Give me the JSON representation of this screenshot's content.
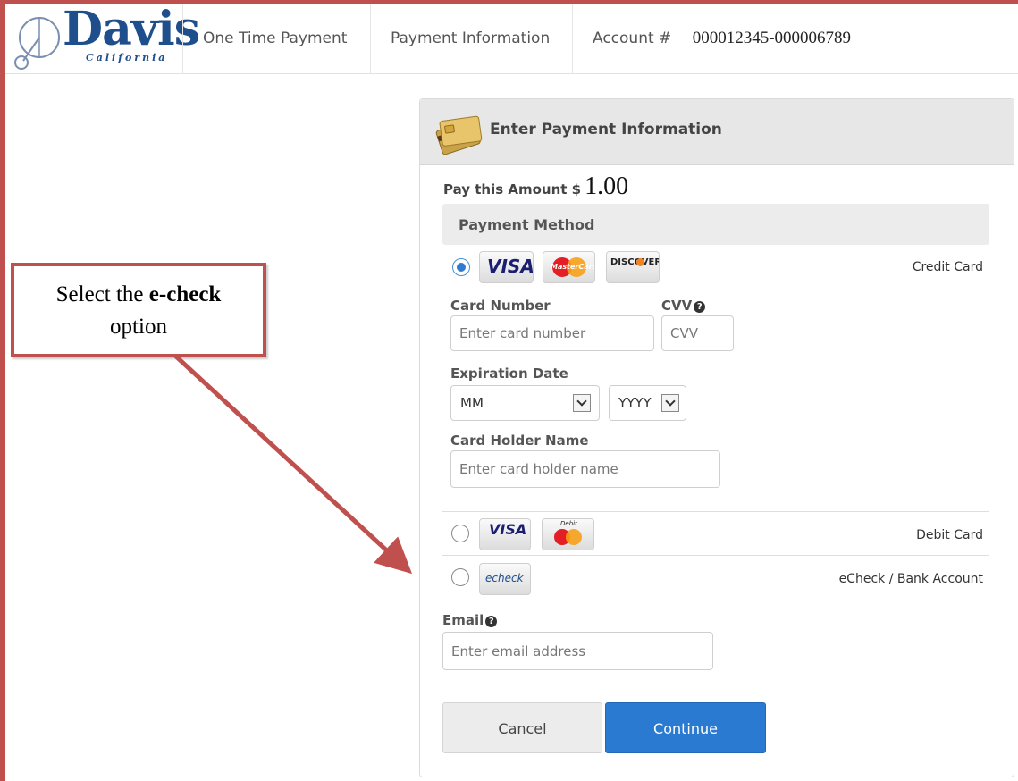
{
  "header": {
    "logo_text": "Davis",
    "logo_subtext": "California",
    "nav": [
      "One Time Payment",
      "Payment Information"
    ],
    "account_label": "Account #",
    "account_number": "000012345-000006789"
  },
  "panel": {
    "title": "Enter Payment Information",
    "pay_label": "Pay this Amount $",
    "pay_amount": "1.00",
    "method_heading": "Payment Method",
    "options": {
      "credit": {
        "label": "Credit Card",
        "selected": true,
        "brands": [
          "VISA",
          "MasterCard",
          "DISCOVER"
        ]
      },
      "debit": {
        "label": "Debit Card",
        "selected": false,
        "brands": [
          "VISA",
          "Debit",
          "MasterCard"
        ]
      },
      "echeck": {
        "label": "eCheck / Bank Account",
        "selected": false,
        "brand": "echeck"
      }
    },
    "fields": {
      "card_number_label": "Card Number",
      "card_number_placeholder": "Enter card number",
      "cvv_label": "CVV",
      "cvv_placeholder": "CVV",
      "expiration_label": "Expiration Date",
      "month_value": "MM",
      "year_value": "YYYY",
      "holder_label": "Card Holder Name",
      "holder_placeholder": "Enter card holder name",
      "email_label": "Email",
      "email_placeholder": "Enter email address"
    },
    "buttons": {
      "cancel": "Cancel",
      "continue": "Continue"
    }
  },
  "callout": {
    "text_before": "Select the",
    "text_bold": "e-check",
    "text_after": "option"
  },
  "colors": {
    "annotation": "#c0504d",
    "primary_button": "#2b7ad1",
    "logo": "#1f4e8c"
  }
}
